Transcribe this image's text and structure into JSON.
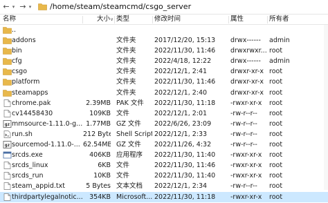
{
  "pathbar": {
    "path": "/home/steam/steamcmd/csgo_server"
  },
  "columns": {
    "name": "名称",
    "size": "大小",
    "type": "类型",
    "modified": "修改时间",
    "attrs": "属性",
    "owner": "所有者"
  },
  "colors": {
    "folder": "#e8b84b",
    "selected_row": "#cce8ff"
  },
  "files": [
    {
      "icon": "folder-icon",
      "name": "..",
      "size": "",
      "type": "",
      "modified": "",
      "attrs": "",
      "owner": ""
    },
    {
      "icon": "folder-icon",
      "name": "addons",
      "size": "",
      "type": "文件夹",
      "modified": "2017/12/20, 15:13",
      "attrs": "drwx------",
      "owner": "admin"
    },
    {
      "icon": "folder-icon",
      "name": "bin",
      "size": "",
      "type": "文件夹",
      "modified": "2022/11/30, 11:46",
      "attrs": "drwxrwxr...",
      "owner": "root"
    },
    {
      "icon": "folder-icon",
      "name": "cfg",
      "size": "",
      "type": "文件夹",
      "modified": "2022/4/18, 12:22",
      "attrs": "drwx------",
      "owner": "admin"
    },
    {
      "icon": "folder-icon",
      "name": "csgo",
      "size": "",
      "type": "文件夹",
      "modified": "2022/12/1, 2:41",
      "attrs": "drwxr-xr-x",
      "owner": "root"
    },
    {
      "icon": "folder-icon",
      "name": "platform",
      "size": "",
      "type": "文件夹",
      "modified": "2022/11/30, 11:46",
      "attrs": "drwxr-xr-x",
      "owner": "root"
    },
    {
      "icon": "folder-icon",
      "name": "steamapps",
      "size": "",
      "type": "文件夹",
      "modified": "2022/12/1, 2:40",
      "attrs": "drwxr-xr-x",
      "owner": "root"
    },
    {
      "icon": "document-icon",
      "name": "chrome.pak",
      "size": "2.39MB",
      "type": "PAK 文件",
      "modified": "2022/11/30, 11:18",
      "attrs": "-rwxr-xr-x",
      "owner": "root"
    },
    {
      "icon": "document-icon",
      "name": "cv14458430",
      "size": "109KB",
      "type": "文件",
      "modified": "2022/12/1, 2:01",
      "attrs": "-rw-r--r--",
      "owner": "root"
    },
    {
      "icon": "gz-archive-icon",
      "name": "mmsource-1.11.0-g...",
      "size": "1.77MB",
      "type": "GZ 文件",
      "modified": "2022/6/26, 23:09",
      "attrs": "-rw-r--r--",
      "owner": "root"
    },
    {
      "icon": "script-icon",
      "name": "run.sh",
      "size": "212 Bytes",
      "type": "Shell Script",
      "modified": "2022/12/1, 2:33",
      "attrs": "-rw-r--r--",
      "owner": "root"
    },
    {
      "icon": "gz-archive-icon",
      "name": "sourcemod-1.11.0-...",
      "size": "62.54MB",
      "type": "GZ 文件",
      "modified": "2022/11/26, 4:32",
      "attrs": "-rw-r--r--",
      "owner": "root"
    },
    {
      "icon": "exe-icon",
      "name": "srcds.exe",
      "size": "406KB",
      "type": "应用程序",
      "modified": "2022/11/30, 11:40",
      "attrs": "-rwxr-xr-x",
      "owner": "root"
    },
    {
      "icon": "document-icon",
      "name": "srcds_linux",
      "size": "6KB",
      "type": "文件",
      "modified": "2022/11/30, 11:46",
      "attrs": "-rwxr-xr-x",
      "owner": "root"
    },
    {
      "icon": "document-icon",
      "name": "srcds_run",
      "size": "10KB",
      "type": "文件",
      "modified": "2022/11/30, 11:40",
      "attrs": "-rwxr-xr-x",
      "owner": "root"
    },
    {
      "icon": "document-icon",
      "name": "steam_appid.txt",
      "size": "5 Bytes",
      "type": "文本文档",
      "modified": "2022/12/1, 2:34",
      "attrs": "-rw-r--r--",
      "owner": "root"
    },
    {
      "icon": "document-icon",
      "name": "thirdpartylegalnotic...",
      "size": "354KB",
      "type": "Microsoft...",
      "modified": "2022/11/30, 11:18",
      "attrs": "-rwxr-xr-x",
      "owner": "root",
      "selected": true
    }
  ]
}
